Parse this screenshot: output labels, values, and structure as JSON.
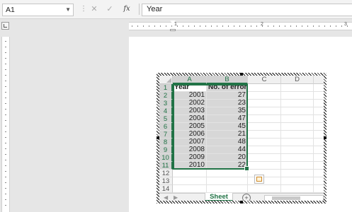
{
  "formula_bar": {
    "name_box": "A1",
    "content": "Year",
    "icons": [
      "cancel-icon",
      "enter-check-icon",
      "insert-function-icon"
    ]
  },
  "ruler": {
    "numbers": [
      "1",
      "2",
      "3"
    ]
  },
  "spreadsheet": {
    "columns": [
      "A",
      "B",
      "C",
      "D"
    ],
    "rows": [
      "1",
      "2",
      "3",
      "4",
      "5",
      "6",
      "7",
      "8",
      "9",
      "10",
      "11",
      "12",
      "13",
      "14"
    ],
    "header": {
      "year": "Year",
      "errors": "No. of errors"
    },
    "data": [
      {
        "year": "2001",
        "errors": "27"
      },
      {
        "year": "2002",
        "errors": "23"
      },
      {
        "year": "2003",
        "errors": "35"
      },
      {
        "year": "2004",
        "errors": "47"
      },
      {
        "year": "2005",
        "errors": "45"
      },
      {
        "year": "2006",
        "errors": "21"
      },
      {
        "year": "2007",
        "errors": "48"
      },
      {
        "year": "2008",
        "errors": "44"
      },
      {
        "year": "2009",
        "errors": "20"
      },
      {
        "year": "2010",
        "errors": "22"
      }
    ],
    "sheet_tab": "Sheet",
    "add_sheet": "+",
    "accent_color": "#217346"
  }
}
